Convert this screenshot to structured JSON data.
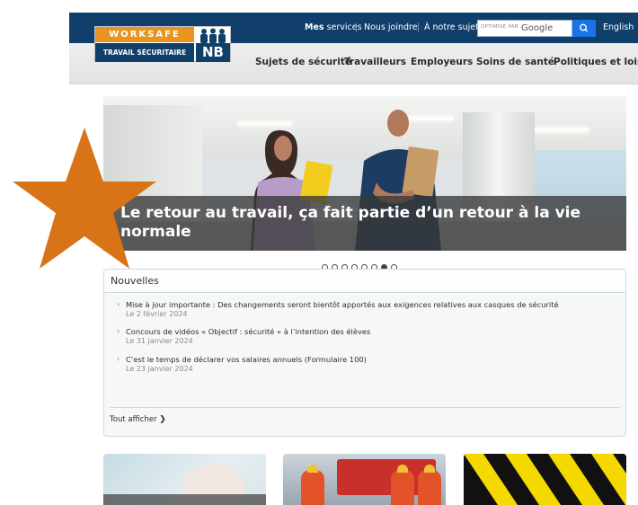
{
  "topbar": {
    "my_services_bold": "Mes",
    "my_services_rest": " services",
    "contact": "Nous joindre",
    "about": "À notre sujet",
    "search_prefix": "OPTIMISÉ PAR",
    "search_brand": "Google",
    "english": "English"
  },
  "logo": {
    "line1": "WORKSAFE",
    "line2": "TRAVAIL SÉCURITAIRE",
    "badge": "NB"
  },
  "nav": {
    "items": [
      "Sujets de sécurité",
      "Travailleurs",
      "Employeurs",
      "Soins de santé",
      "Politiques et lois"
    ]
  },
  "hero": {
    "caption": "Le retour au travail, ça fait partie d’un retour à la vie normale",
    "slides_total": 8,
    "active_slide": 7
  },
  "news": {
    "title": "Nouvelles",
    "items": [
      {
        "text": "Mise à jour importante : Des changements seront bientôt apportés aux exigences relatives aux casques de sécurité",
        "date": "Le 2 février 2024"
      },
      {
        "text": "Concours de vidéos « Objectif : sécurité » à l’intention des élèves",
        "date": "Le 31 janvier 2024"
      },
      {
        "text": "C’est le temps de déclarer vos salaires annuels (Formulaire 100)",
        "date": "Le 23 janvier 2024"
      }
    ],
    "view_all": "Tout afficher"
  },
  "colors": {
    "header_navy": "#0f3f6a",
    "logo_orange": "#e89422",
    "search_blue": "#1a73e8",
    "star_orange": "#d97317"
  },
  "icons": [
    "search-icon",
    "chevron-right-icon",
    "star-shape"
  ]
}
